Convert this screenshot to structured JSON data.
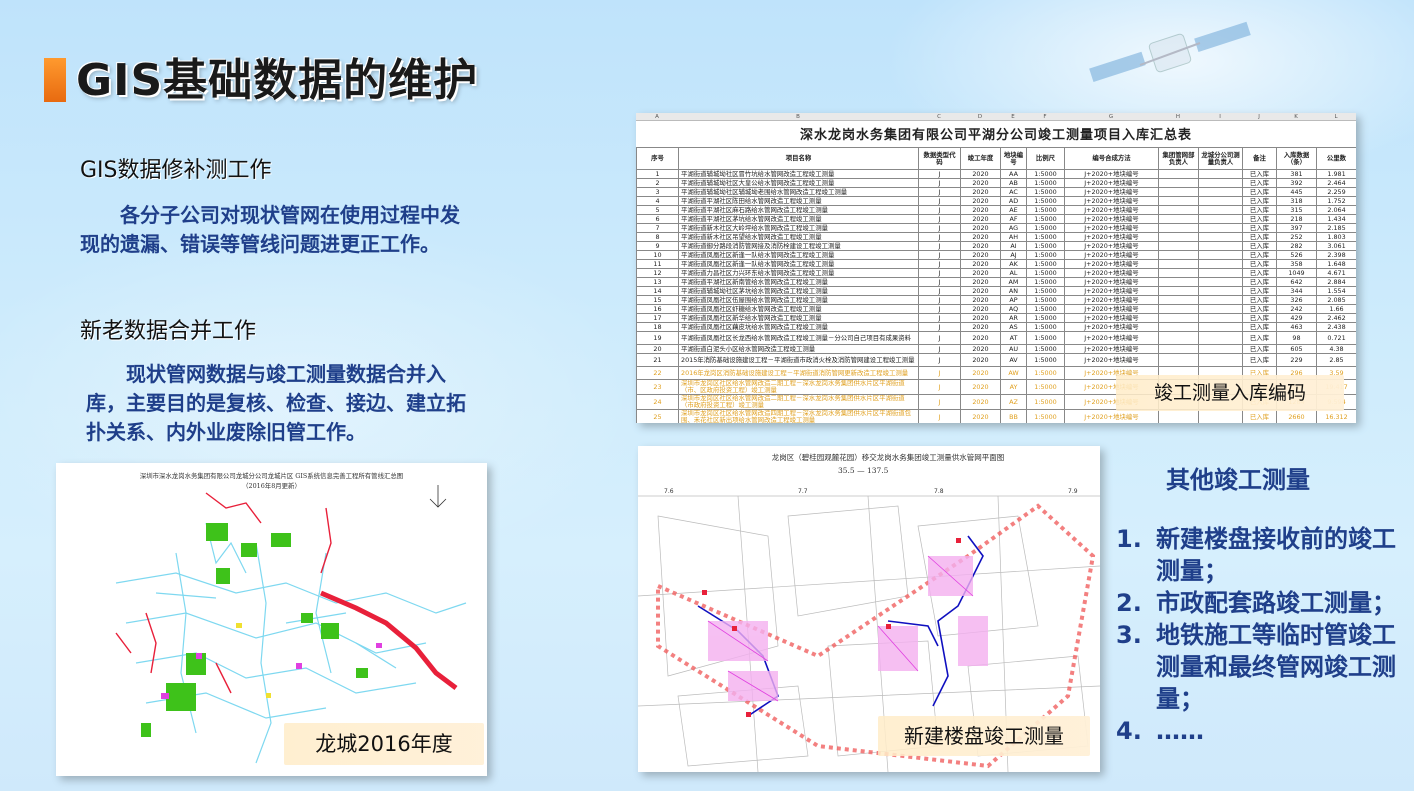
{
  "title": "GIS基础数据的维护",
  "sections": [
    {
      "heading": "GIS数据修补测工作",
      "body": "各分子公司对现状管网在使用过程中发现的遗漏、错误等管线问题进更正工作。"
    },
    {
      "heading": "新老数据合并工作",
      "body": "现状管网数据与竣工测量数据合并入库，主要目的是复核、检查、接边、建立拓扑关系、内外业废除旧管工作。"
    }
  ],
  "images": {
    "map_left": {
      "title": "深圳市深水龙岗水务集团有限公司龙城分公司龙城片区 GIS系统信息完善工程所有管线汇总图",
      "subtitle": "（2016年8月更新）",
      "caption": "龙城2016年度"
    },
    "sheet": {
      "caption": "竣工测量入库编码"
    },
    "map_right": {
      "title": "龙岗区（碧桂园观麓花园）移交龙岗水务集团竣工测量供水管网平面图",
      "range": "35.5 — 137.5",
      "ticks": [
        "7.6",
        "7.7",
        "7.8",
        "7.9"
      ],
      "caption": "新建楼盘竣工测量"
    }
  },
  "spreadsheet": {
    "col_letters": [
      "A",
      "B",
      "C",
      "D",
      "E",
      "F",
      "G",
      "H",
      "I",
      "J",
      "K",
      "L"
    ],
    "title": "深水龙岗水务集团有限公司平湖分公司竣工测量项目入库汇总表",
    "headers": [
      "序号",
      "项目名称",
      "数据类型代码",
      "竣工年度",
      "地块编号",
      "比例尺",
      "编号合成方法",
      "集团管网部负责人",
      "龙城分公司测量负责人",
      "备注",
      "入库数据（条）",
      "公里数"
    ],
    "rows": [
      [
        "1",
        "平湖街道辅城坳社区冒竹坑给水管网改造工程竣工测量",
        "J",
        "2020",
        "AA",
        "1:5000",
        "J+2020+地块编号",
        "已入库",
        "381",
        "1.981"
      ],
      [
        "2",
        "平湖街道辅城坳社区大皇公给水管网改造工程竣工测量",
        "J",
        "2020",
        "AB",
        "1:5000",
        "J+2020+地块编号",
        "已入库",
        "392",
        "2.464"
      ],
      [
        "3",
        "平湖街道辅城坳社区辅城坳老围给水管网改造工程竣工测量",
        "J",
        "2020",
        "AC",
        "1:5000",
        "J+2020+地块编号",
        "已入库",
        "445",
        "2.259"
      ],
      [
        "4",
        "平湖街道平湖社区陈田给水管网改造工程竣工测量",
        "J",
        "2020",
        "AD",
        "1:5000",
        "J+2020+地块编号",
        "已入库",
        "318",
        "1.752"
      ],
      [
        "5",
        "平湖街道平湖社区麻石路给水管网改造工程竣工测量",
        "J",
        "2020",
        "AE",
        "1:5000",
        "J+2020+地块编号",
        "已入库",
        "315",
        "2.064"
      ],
      [
        "6",
        "平湖街道平湖社区茅坑给水管网改造工程竣工测量",
        "J",
        "2020",
        "AF",
        "1:5000",
        "J+2020+地块编号",
        "已入库",
        "218",
        "1.434"
      ],
      [
        "7",
        "平湖街道新木社区大岭坪给水管网改造工程竣工测量",
        "J",
        "2020",
        "AG",
        "1:5000",
        "J+2020+地块编号",
        "已入库",
        "397",
        "2.185"
      ],
      [
        "8",
        "平湖街道新木社区吊望给水管网改造工程竣工测量",
        "J",
        "2020",
        "AH",
        "1:5000",
        "J+2020+地块编号",
        "已入库",
        "252",
        "1.803"
      ],
      [
        "9",
        "平湖街道御分路段消防管网接及消防栓建设工程竣工测量",
        "J",
        "2020",
        "AI",
        "1:5000",
        "J+2020+地块编号",
        "已入库",
        "282",
        "3.061"
      ],
      [
        "10",
        "平湖街道凤凰社区新逢一队给水管网改造工程竣工测量",
        "J",
        "2020",
        "AJ",
        "1:5000",
        "J+2020+地块编号",
        "已入库",
        "526",
        "2.398"
      ],
      [
        "11",
        "平湖街道凤凰社区新逢一队给水管网改造工程竣工测量",
        "J",
        "2020",
        "AK",
        "1:5000",
        "J+2020+地块编号",
        "已入库",
        "358",
        "1.648"
      ],
      [
        "12",
        "平湖街道力昌社区力兴环东给水管网改造工程竣工测量",
        "J",
        "2020",
        "AL",
        "1:5000",
        "J+2020+地块编号",
        "已入库",
        "1049",
        "4.671"
      ],
      [
        "13",
        "平湖街道平湖社区新南管给水管网改造工程竣工测量",
        "J",
        "2020",
        "AM",
        "1:5000",
        "J+2020+地块编号",
        "已入库",
        "642",
        "2.884"
      ],
      [
        "14",
        "平湖街道辅城坳社区茅坑给水管网改造工程竣工测量",
        "J",
        "2020",
        "AN",
        "1:5000",
        "J+2020+地块编号",
        "已入库",
        "344",
        "1.554"
      ],
      [
        "15",
        "平湖街道凤凰社区伍屋围给水管网改造工程竣工测量",
        "J",
        "2020",
        "AP",
        "1:5000",
        "J+2020+地块编号",
        "已入库",
        "326",
        "2.085"
      ],
      [
        "16",
        "平湖街道凤凰社区虾糖给水管网改造工程竣工测量",
        "J",
        "2020",
        "AQ",
        "1:5000",
        "J+2020+地块编号",
        "已入库",
        "242",
        "1.66"
      ],
      [
        "17",
        "平湖街道凤凰社区新华给水管网改造工程竣工测量",
        "J",
        "2020",
        "AR",
        "1:5000",
        "J+2020+地块编号",
        "已入库",
        "429",
        "2.462"
      ],
      [
        "18",
        "平湖街道凤凰社区藕皮坑给水管网改造工程竣工测量",
        "J",
        "2020",
        "AS",
        "1:5000",
        "J+2020+地块编号",
        "已入库",
        "463",
        "2.438"
      ],
      [
        "19",
        "平湖街道凤凰社区长龙西给水管网改造工程竣工测量－分公司自己项目有成果资料",
        "J",
        "2020",
        "AT",
        "1:5000",
        "J+2020+地块编号",
        "已入库",
        "98",
        "0.721"
      ],
      [
        "20",
        "平湖街道白泥头小区给水管网改造工程竣工测量",
        "J",
        "2020",
        "AU",
        "1:5000",
        "J+2020+地块编号",
        "已入库",
        "605",
        "4.38"
      ],
      [
        "21",
        "2015年消防基础设施建设工程－平湖街道市政消火栓及消防管网建设工程竣工测量",
        "J",
        "2020",
        "AV",
        "1:5000",
        "J+2020+地块编号",
        "已入库",
        "229",
        "2.85"
      ],
      [
        "22",
        "2016年龙岗区消防基础设施建设工程－平湖街道消防管网更新改造工程竣工测量",
        "J",
        "2020",
        "AW",
        "1:5000",
        "J+2020+地块编号",
        "已入库",
        "296",
        "3.59"
      ],
      [
        "23",
        "深圳市龙岗区社区给水管网改造二期工程－深水龙岗水务集团供水片区平湖街道（市、区政府投资工程）竣工测量",
        "J",
        "2020",
        "AY",
        "1:5000",
        "J+2020+地块编号",
        "已入库",
        "2575",
        "19.417"
      ],
      [
        "24",
        "深圳市龙岗区社区给水管网改造二期工程－深水龙岗水务集团供水片区平湖街道（市政府投资工程）竣工测量",
        "J",
        "2020",
        "AZ",
        "1:5000",
        "J+2020+地块编号",
        "已入库",
        "1284",
        "9.594"
      ],
      [
        "25",
        "深圳市龙岗区社区给水管网改造四期工程－深水龙岗水务集团供水片区平湖街道包围、禾花社区新出项给水管网改造工程竣工测量",
        "J",
        "2020",
        "BB",
        "1:5000",
        "J+2020+地块编号",
        "已入库",
        "2660",
        "16.312"
      ]
    ]
  },
  "other_heading": "其他竣工测量",
  "other_list": [
    {
      "num": "1.",
      "text": "新建楼盘接收前的竣工测量；"
    },
    {
      "num": "2.",
      "text": "市政配套路竣工测量；"
    },
    {
      "num": "3.",
      "text": "地铁施工等临时管竣工测量和最终管网竣工测量；"
    },
    {
      "num": "4.",
      "text": "……"
    }
  ],
  "colors": {
    "accent_orange": "#f07e1e",
    "body_blue": "#1f3f8a",
    "pipe_red": "#e8203a",
    "pipe_green": "#3ec21a",
    "pipe_cyan": "#7ed8f0",
    "pipe_blue": "#1010c0",
    "pipe_magenta": "#e040e0"
  }
}
